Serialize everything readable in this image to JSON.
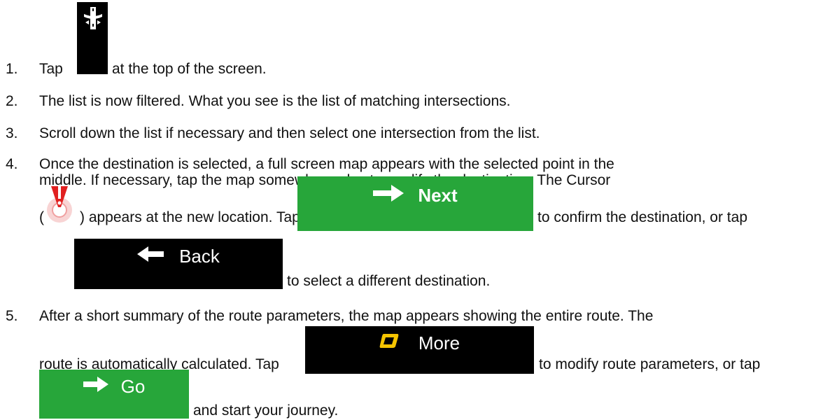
{
  "steps": [
    {
      "number": "1.",
      "text_before": "Tap",
      "text_after": "at the top of the screen."
    },
    {
      "number": "2.",
      "text": "The list is now filtered. What you see is the list of matching intersections."
    },
    {
      "number": "3.",
      "text": "Scroll down the list if necessary and then select one intersection from the list."
    },
    {
      "number": "4.",
      "line1": "Once the destination is selected, a full screen map appears with the selected point in the",
      "line2": "middle. If necessary, tap the map somewhere else to modify the destination. The Cursor",
      "open_paren": "(",
      "after_cursor": ") appears at the new location. Tap",
      "after_next": "to confirm the destination, or tap",
      "after_back": "to select a different destination."
    },
    {
      "number": "5.",
      "line1": "After a short summary of the route parameters, the map appears showing the entire route. The",
      "line2": "route is automatically calculated. Tap",
      "after_more": "to modify route parameters, or tap",
      "after_go": "and start your journey."
    }
  ],
  "buttons": {
    "next": {
      "label": "Next",
      "icon": "arrow-right-icon",
      "color": "#27a63a"
    },
    "back": {
      "label": "Back",
      "icon": "arrow-left-icon",
      "color": "#000000"
    },
    "more": {
      "label": "More",
      "icon": "more-rounded-square-icon",
      "color": "#000000",
      "icon_color": "#f5c400"
    },
    "go": {
      "label": "Go",
      "icon": "arrow-right-icon",
      "color": "#27a63a"
    }
  },
  "icons": {
    "highway_button": "highway-intersection-icon",
    "cursor": "map-cursor-icon"
  }
}
